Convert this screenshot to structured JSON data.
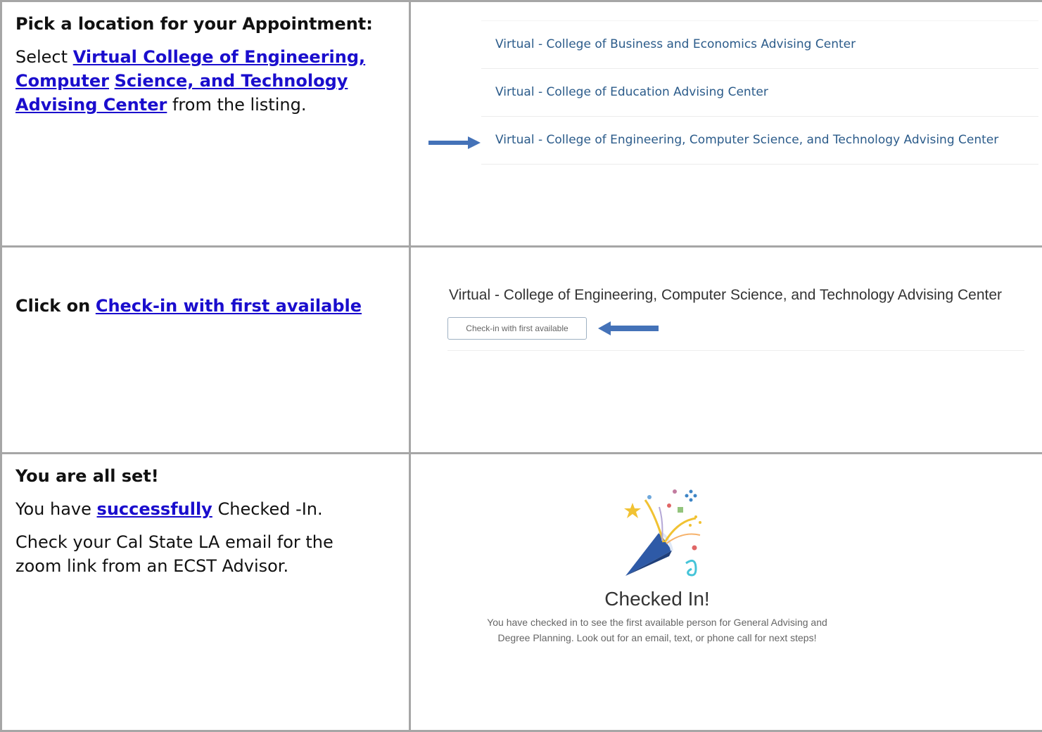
{
  "row1": {
    "heading": "Pick a location for your Appointment:",
    "select_word": "Select",
    "link_part1": "Virtual College of Engineering, Computer",
    "link_part2": "Science, and Technology Advising Center",
    "suffix": "from the listing.",
    "list_items": [
      "Virtual - College of Business and Economics Advising Center",
      "Virtual - College of Education Advising Center",
      "Virtual - College of Engineering, Computer Science, and Technology Advising Center"
    ]
  },
  "row2": {
    "click_on": "Click on",
    "link": "Check-in with first available",
    "center_title": "Virtual - College of Engineering, Computer Science, and Technology Advising Center",
    "button_label": "Check-in with first available"
  },
  "row3": {
    "heading": "You are all set!",
    "line1_prefix": "You have",
    "line1_link": "successfully",
    "line1_suffix": "Checked -In.",
    "line2": "Check your Cal State LA email for the zoom link from an ECST Advisor.",
    "checked_title": "Checked In!",
    "message_line1": "You have checked in to see the first available person for General Advising and",
    "message_line2": "Degree Planning. Look out for an email, text, or phone call for next steps!"
  },
  "colors": {
    "link": "#1a0dcd",
    "list_text": "#2b5b8a",
    "arrow": "#4472b8",
    "border": "#a6a6a6"
  },
  "icons": {
    "arrow_right": "arrow-right-icon",
    "arrow_left": "arrow-left-icon",
    "confetti": "party-popper-icon"
  }
}
